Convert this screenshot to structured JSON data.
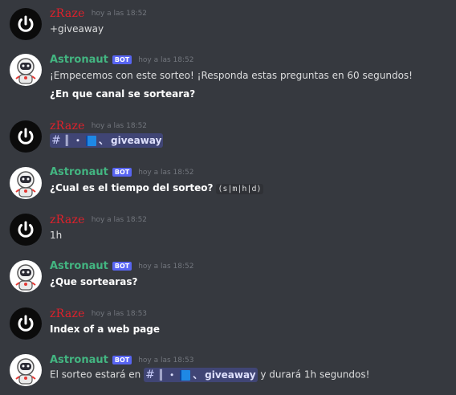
{
  "users": {
    "zraze": {
      "name": "zRaze"
    },
    "astronaut": {
      "name": "Astronaut",
      "badge": "BOT"
    }
  },
  "messages": [
    {
      "author": "zRaze",
      "timestamp": "hoy a las 18:52",
      "lines": [
        "+giveaway"
      ]
    },
    {
      "author": "Astronaut",
      "badge": "BOT",
      "timestamp": "hoy a las 18:52",
      "lines": [
        "¡Empecemos con este sorteo! ¡Responda estas preguntas en 60 segundos!",
        "¿En que canal se sorteara?"
      ]
    },
    {
      "author": "zRaze",
      "timestamp": "hoy a las 18:52",
      "channel_mention": {
        "hash": "#",
        "separator": "║",
        "dot": "・",
        "comma": "、",
        "name": "giveaway"
      }
    },
    {
      "author": "Astronaut",
      "badge": "BOT",
      "timestamp": "hoy a las 18:52",
      "question": "¿Cual es el tiempo del sorteo?",
      "code": "(s|m|h|d)"
    },
    {
      "author": "zRaze",
      "timestamp": "hoy a las 18:52",
      "lines": [
        "1h"
      ]
    },
    {
      "author": "Astronaut",
      "badge": "BOT",
      "timestamp": "hoy a las 18:52",
      "lines": [
        "¿Que sortearas?"
      ]
    },
    {
      "author": "zRaze",
      "timestamp": "hoy a las 18:53",
      "lines": [
        "Index of a web page"
      ]
    },
    {
      "author": "Astronaut",
      "badge": "BOT",
      "timestamp": "hoy a las 18:53",
      "prefix": "El sorteo estará en",
      "channel_mention": {
        "hash": "#",
        "separator": "║",
        "dot": "・",
        "comma": "、",
        "name": "giveaway"
      },
      "suffix": "y durará 1h segundos!"
    }
  ],
  "icons": {
    "zraze_avatar": "power-icon",
    "astronaut_avatar": "astronaut-icon",
    "channel_book": "blue-book-icon"
  },
  "colors": {
    "background": "#36393f",
    "zraze_name": "#e0212b",
    "astronaut_name": "#43b581",
    "bot_badge": "#5865f2",
    "mention_bg": "rgba(88,101,242,0.3)"
  }
}
